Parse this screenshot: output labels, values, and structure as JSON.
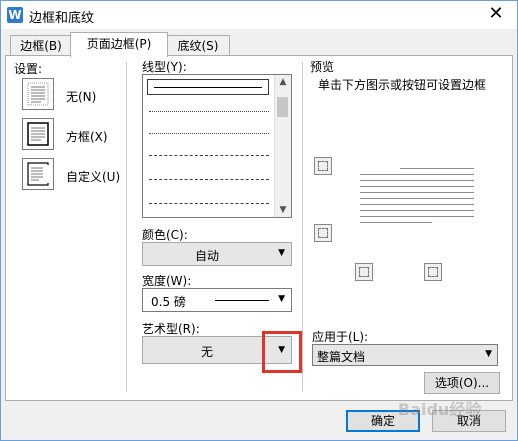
{
  "window": {
    "title": "边框和底纹",
    "app_icon_letter": "W",
    "close_glyph": "✕"
  },
  "tabs": [
    {
      "label": "边框(B)",
      "active": false
    },
    {
      "label": "页面边框(P)",
      "active": true
    },
    {
      "label": "底纹(S)",
      "active": false
    }
  ],
  "settings": {
    "heading": "设置:",
    "items": [
      {
        "label": "无(N)",
        "icon": "none-icon"
      },
      {
        "label": "方框(X)",
        "icon": "box-icon"
      },
      {
        "label": "自定义(U)",
        "icon": "custom-icon"
      }
    ]
  },
  "line_style": {
    "label": "线型(Y):",
    "styles": [
      "solid",
      "dotted",
      "dense-dashed",
      "dashed",
      "long-dashed",
      "dash-dot",
      "dash-dot-dot"
    ],
    "selected": "solid"
  },
  "color": {
    "label": "颜色(C):",
    "value": "自动"
  },
  "width": {
    "label": "宽度(W):",
    "value": "0.5  磅"
  },
  "art": {
    "label": "艺术型(R):",
    "value": "无"
  },
  "preview": {
    "label": "预览",
    "hint": "单击下方图示或按钮可设置边框",
    "buttons": [
      "top-border-icon",
      "bottom-border-icon",
      "left-border-icon",
      "right-border-icon"
    ]
  },
  "apply_to": {
    "label": "应用于(L):",
    "value": "整篇文档"
  },
  "buttons": {
    "options": "选项(O)...",
    "ok": "确定",
    "cancel": "取消"
  },
  "watermark": "Baidu经验",
  "colors": {
    "highlight": "#e0342c",
    "accent": "#0078d7",
    "app_icon": "#2f7ad6"
  }
}
